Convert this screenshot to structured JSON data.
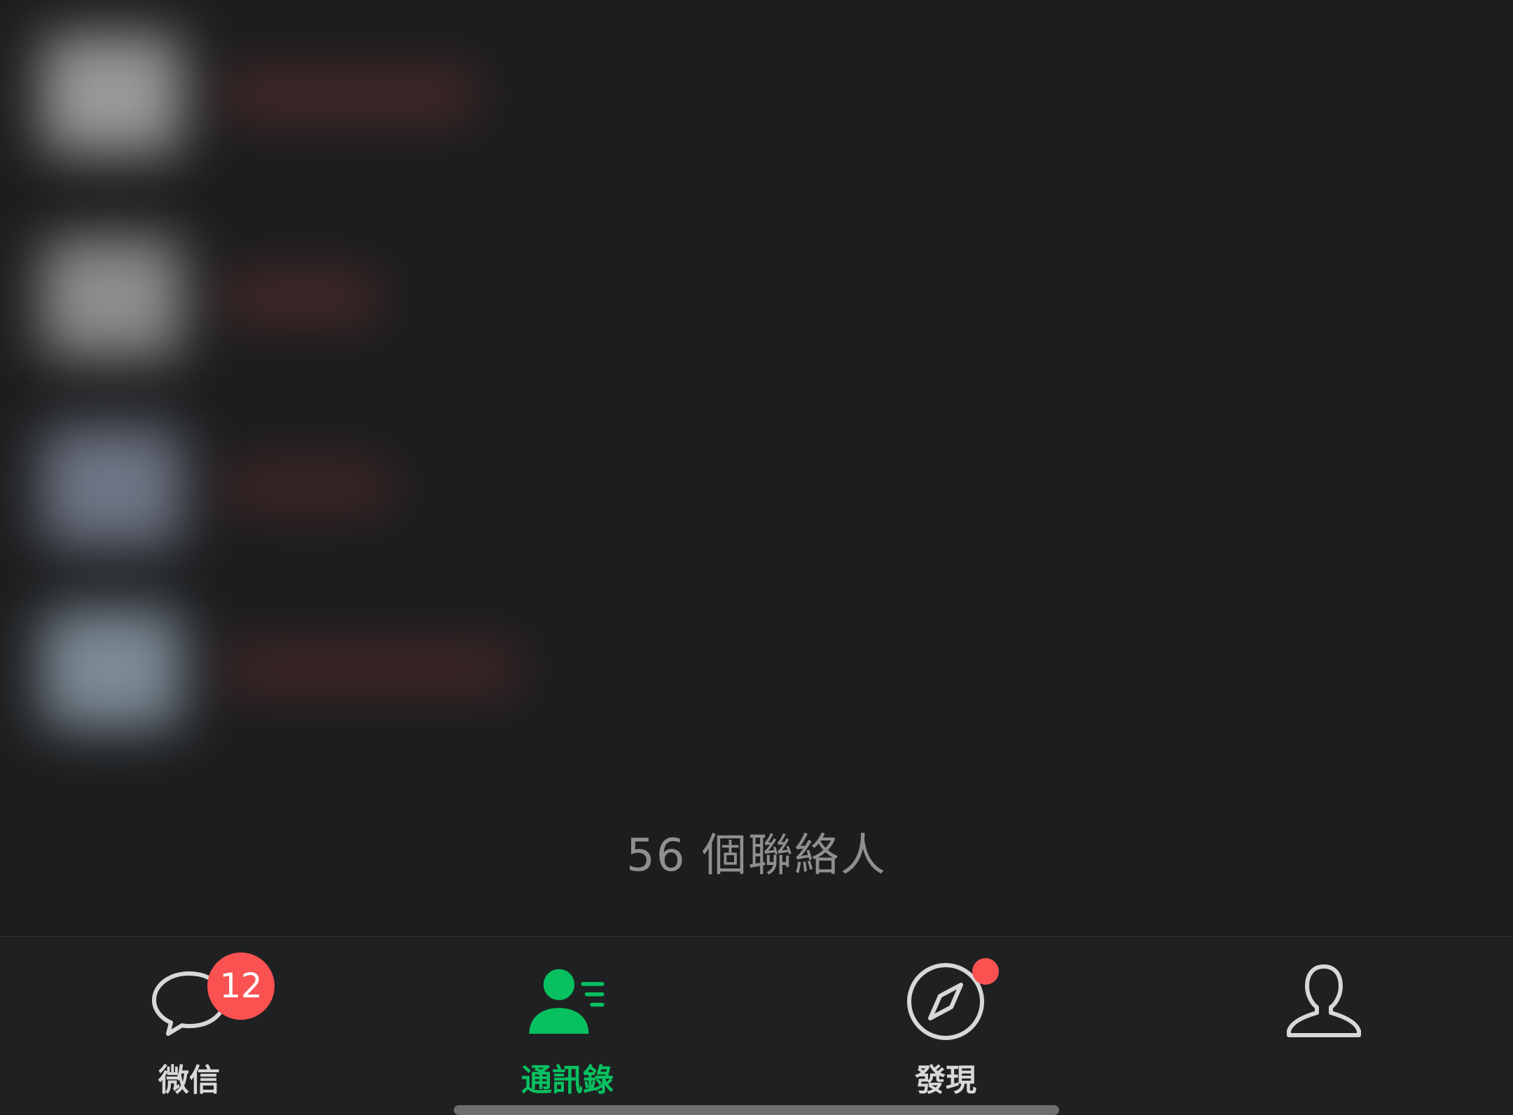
{
  "contacts_footer": {
    "count_text": "56 個聯絡人"
  },
  "tab_bar": {
    "tabs": [
      {
        "label": "微信",
        "icon": "chat-bubble-icon",
        "badge": "12",
        "active": false
      },
      {
        "label": "通訊錄",
        "icon": "contacts-icon",
        "active": true
      },
      {
        "label": "發現",
        "icon": "compass-icon",
        "dot": true,
        "active": false
      },
      {
        "label": "",
        "icon": "person-icon",
        "active": false
      }
    ]
  },
  "colors": {
    "background": "#1c1d1e",
    "tab_bar": "#1f2021",
    "active_green": "#07c160",
    "badge_red": "#fa5151",
    "inactive_label": "#d8d8d8",
    "muted_text": "#8e8f90"
  }
}
